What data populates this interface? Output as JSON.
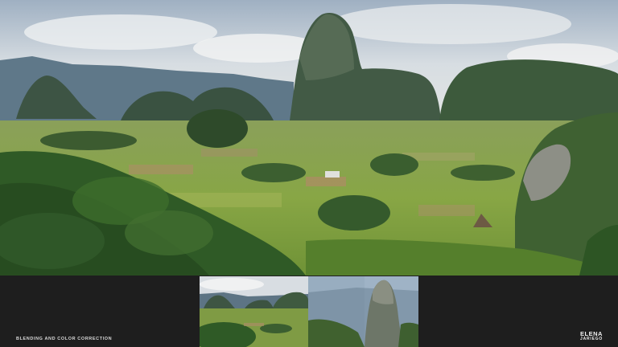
{
  "caption": "BLENDING AND COLOR CORRECTION",
  "logo": {
    "line1": "ELENA",
    "line2": "JARIEGO"
  },
  "images": {
    "main": "vinales-valley-mogotes-photo",
    "thumb_left": "valley-panorama-source-photo",
    "thumb_right": "mogote-rock-source-photo"
  },
  "colors": {
    "background": "#1e1e1e",
    "sky": "#c9d3dc",
    "mountain": "#2f4a3a",
    "field": "#7d9a3e",
    "text": "#d8d8d8"
  }
}
